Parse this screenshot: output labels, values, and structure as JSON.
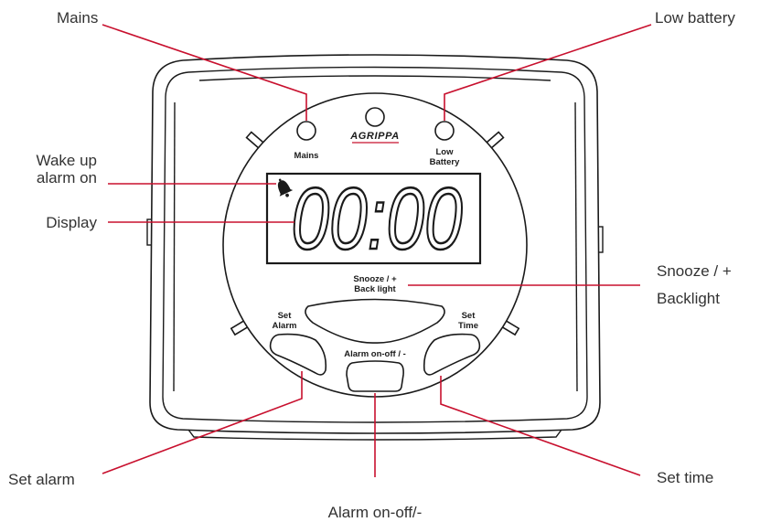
{
  "device": {
    "brand": "AGRIPPA",
    "indicators": {
      "mains_label": "Mains",
      "low_battery_line1": "Low",
      "low_battery_line2": "Battery"
    },
    "display": {
      "time": "00:00",
      "alarm_icon": "bell-icon"
    },
    "buttons": {
      "snooze_line1": "Snooze / +",
      "snooze_line2": "Back light",
      "set_alarm_line1": "Set",
      "set_alarm_line2": "Alarm",
      "set_time_line1": "Set",
      "set_time_line2": "Time",
      "alarm_on_off": "Alarm on-off / -"
    }
  },
  "callouts": {
    "mains": "Mains",
    "low_battery": "Low battery",
    "wake_up_line1": "Wake up",
    "wake_up_line2": "alarm on",
    "display": "Display",
    "snooze_line1": "Snooze / +",
    "snooze_line2": "Backlight",
    "set_alarm": "Set alarm",
    "alarm_on_off": "Alarm on-off/-",
    "set_time": "Set time"
  },
  "colors": {
    "callout_line": "#c8102e",
    "outline": "#1a1a1a",
    "callout_text": "#333333",
    "brand_underline": "#c8102e"
  }
}
